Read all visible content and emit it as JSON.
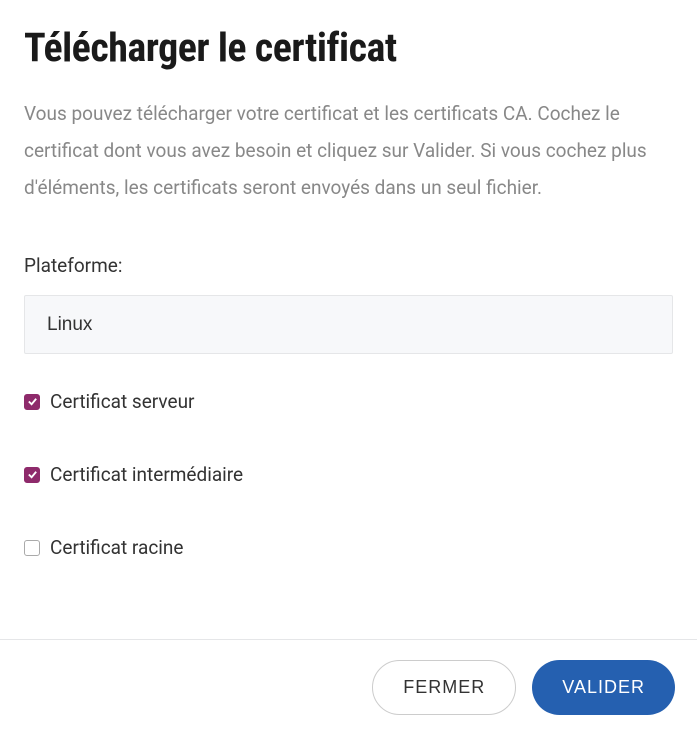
{
  "dialog": {
    "title": "Télécharger le certificat",
    "description": "Vous pouvez télécharger votre certificat et les certificats CA. Cochez le certificat dont vous avez besoin et cliquez sur Valider. Si vous cochez plus d'éléments, les certificats seront envoyés dans un seul fichier."
  },
  "platform": {
    "label": "Plateforme:",
    "selected": "Linux"
  },
  "checkboxes": {
    "server": {
      "label": "Certificat serveur",
      "checked": true
    },
    "intermediate": {
      "label": "Certificat intermédiaire",
      "checked": true
    },
    "root": {
      "label": "Certificat racine",
      "checked": false
    }
  },
  "footer": {
    "close": "FERMER",
    "validate": "VALIDER"
  }
}
